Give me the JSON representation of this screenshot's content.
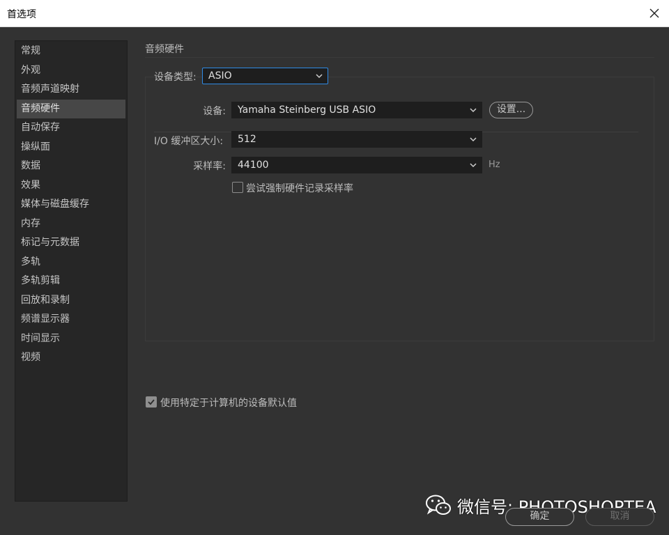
{
  "window": {
    "title": "首选项",
    "close_icon": "close-icon"
  },
  "sidebar": {
    "items": [
      {
        "label": "常规"
      },
      {
        "label": "外观"
      },
      {
        "label": "音频声道映射"
      },
      {
        "label": "音频硬件",
        "active": true
      },
      {
        "label": "自动保存"
      },
      {
        "label": "操纵面"
      },
      {
        "label": "数据"
      },
      {
        "label": "效果"
      },
      {
        "label": "媒体与磁盘缓存"
      },
      {
        "label": "内存"
      },
      {
        "label": "标记与元数据"
      },
      {
        "label": "多轨"
      },
      {
        "label": "多轨剪辑"
      },
      {
        "label": "回放和录制"
      },
      {
        "label": "频谱显示器"
      },
      {
        "label": "时间显示"
      },
      {
        "label": "视频"
      }
    ]
  },
  "main": {
    "section_title": "音频硬件",
    "device_type": {
      "label": "设备类型:",
      "value": "ASIO"
    },
    "device": {
      "label": "设备:",
      "value": "Yamaha Steinberg USB ASIO",
      "settings_button": "设置..."
    },
    "buffer": {
      "label": "I/O 缓冲区大小:",
      "value": "512"
    },
    "sample_rate": {
      "label": "采样率:",
      "value": "44100",
      "unit": "Hz"
    },
    "force_rate": {
      "label": "尝试强制硬件记录采样率",
      "checked": false
    },
    "use_defaults": {
      "label": "使用特定于计算机的设备默认值",
      "checked": true
    }
  },
  "footer": {
    "ok_button": "确定",
    "cancel_button": "取消",
    "watermark": "微信号: PHOTOSHOPTEA"
  },
  "colors": {
    "background": "#323232",
    "sidebar": "#262626",
    "active_item": "#474747",
    "focus": "#2f8be6"
  }
}
